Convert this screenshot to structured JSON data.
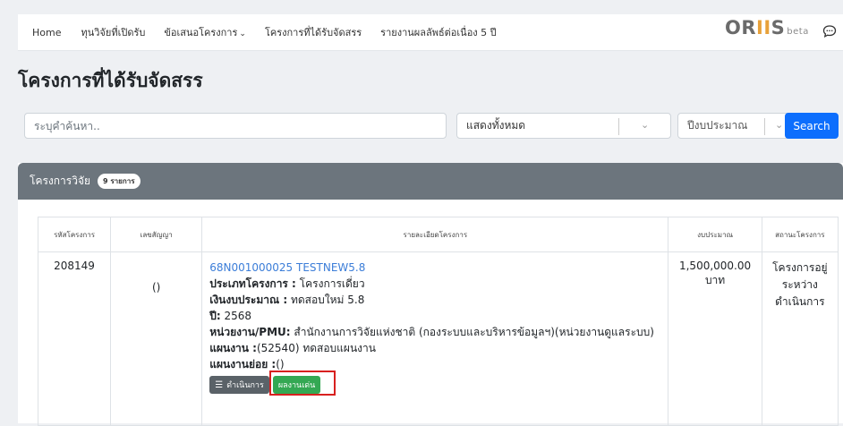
{
  "nav": {
    "items": [
      {
        "label": "Home"
      },
      {
        "label": "ทุนวิจัยที่เปิดรับ"
      },
      {
        "label": "ข้อเสนอโครงการ",
        "has_dropdown": true
      },
      {
        "label": "โครงการที่ได้รับจัดสรร"
      },
      {
        "label": "รายงานผลลัพธ์ต่อเนื่อง 5 ปี"
      }
    ],
    "brand": {
      "main": "ORIIS",
      "suffix": "beta"
    },
    "chat_icon": "chat-bubble-icon"
  },
  "page_title": "โครงการที่ได้รับจัดสรร",
  "search": {
    "placeholder": "ระบุคำค้นหา..",
    "filter_value": "แสดงทั้งหมด",
    "year_placeholder": "ปีงบประมาณ",
    "button_label": "Search"
  },
  "card": {
    "title": "โครงการวิจัย",
    "count_badge": "9 รายการ",
    "columns": [
      "รหัสโครงการ",
      "เลขสัญญา",
      "รายละเอียดโครงการ",
      "งบประมาณ",
      "สถานะโครงการ"
    ],
    "rows": [
      {
        "project_id": "208149",
        "contract_no": "()",
        "detail": {
          "link": "68N001000025 TESTNEW5.8",
          "type_label": "ประเภทโครงการ :",
          "type_value": " โครงการเดี่ยว",
          "fund_label": "เงินงบประมาณ :",
          "fund_value": " ทดสอบใหม่ 5.8",
          "year_label": "ปี:",
          "year_value": " 2568",
          "unit_label": "หน่วยงาน/PMU:",
          "unit_value": " สำนักงานการวิจัยแห่งชาติ (กองระบบและบริหารข้อมูลฯ)(หน่วยงานดูแลระบบ)",
          "plan_label": "แผนงาน :",
          "plan_value": "(52540) ทดสอบแผนงาน",
          "subplan_label": "แผนงานย่อย :",
          "subplan_value": "()"
        },
        "budget": "1,500,000.00 บาท",
        "status": "โครงการอยู่ระหว่างดำเนินการ",
        "actions": {
          "operate": "ดำเนินการ",
          "highlight": "ผลงานเด่น"
        }
      }
    ]
  },
  "colors": {
    "primary": "#0d6efd",
    "header": "#6c757d",
    "success": "#34a853",
    "highlight_border": "#d8201f",
    "link": "#3b7dd8"
  }
}
